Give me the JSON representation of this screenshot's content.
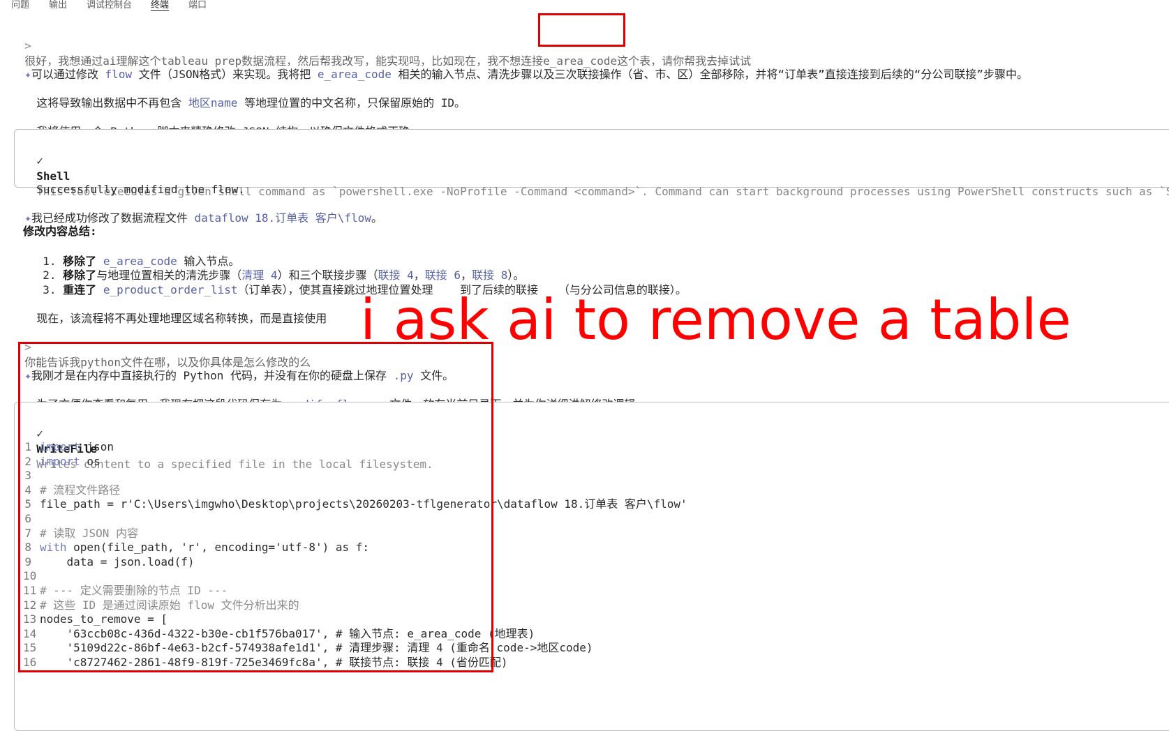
{
  "tabs": [
    "问题",
    "输出",
    "调试控制台",
    "终端",
    "端口"
  ],
  "messages": {
    "user1": "很好，我想通过ai理解这个tableau prep数据流程，然后帮我改写，能实现吗，比如现在，我不想连接e_area_code这个表，请你帮我去掉试试",
    "ai1_a": "可以通过修改 ",
    "ai1_flow": "flow",
    "ai1_b": " 文件（JSON格式）来实现。我将把 ",
    "ai1_code": "e_area_code",
    "ai1_c": " 相关的输入节点、清洗步骤以及三次联接操作（省、市、区）全部移除，并将“订单表”直接连接到后续的“分公司联接”步骤中。",
    "ai2_a": "这将导致输出数据中不再包含 ",
    "ai2_name": "地区name",
    "ai2_b": " 等地理位置的中文名称，只保留原始的 ID。",
    "ai3": "我将使用一个 Python 脚本来精确修改 JSON 结构，以确保文件格式正确。",
    "shell_check": "✓",
    "shell_name": "Shell",
    "shell_desc": "This tool executes a given shell command as `powershell.exe -NoProfile -Command <command>`. Command can start background processes using PowerShell constructs such as `Start",
    "shell_result": "Successfully modified the flow.",
    "ai4_a": "我已经成功修改了数据流程文件 ",
    "ai4_path": "dataflow 18.订单表 客户\\flow",
    "ai4_b": "。",
    "summary_title": "修改内容总结:",
    "item1_n": "1.",
    "item1_bold": "移除了",
    "item1_code": "e_area_code",
    "item1_rest": " 输入节点。",
    "item2_n": "2.",
    "item2_bold": "移除了",
    "item2_a": "与地理位置相关的清洗步骤（",
    "item2_c1": "清理 4",
    "item2_b": "）和三个联接步骤（",
    "item2_c2": "联接 4",
    "item2_sep1": "，",
    "item2_c3": "联接 6",
    "item2_sep2": "，",
    "item2_c4": "联接 8",
    "item2_end": "）。",
    "item3_n": "3.",
    "item3_bold": "重连了",
    "item3_code": "e_product_order_list",
    "item3_rest": "（订单表），使其直接跳过地理位置处理    到了后续的联接   （与分公司信息的联接）。",
    "ai5": "现在，该流程将不再处理地理区域名称转换，而是直接使用",
    "user2": "你能告诉我python文件在哪，以及你具体是怎么修改的么",
    "ai6_a": "我刚才是在内存中直接执行的 Python 代码，并没有在你的硬盘上保存 ",
    "ai6_py": ".py",
    "ai6_b": " 文件。",
    "ai7_a": "为了方便你查看和复用，我现在把这段代码保存为 ",
    "ai7_file": "modify_flow.py",
    "ai7_b": " 文件，放在当前目录下，并为你详细讲解修改逻辑。",
    "wf_check": "✓",
    "wf_name": "WriteFile",
    "wf_desc": "Writes content to a specified file in the local filesystem."
  },
  "code_lines": [
    {
      "n": "1",
      "kw": "import",
      "rest": " json"
    },
    {
      "n": "2",
      "kw": "import",
      "rest": " os"
    },
    {
      "n": "3",
      "kw": "",
      "rest": ""
    },
    {
      "n": "4",
      "kw": "",
      "rest": "# 流程文件路径"
    },
    {
      "n": "5",
      "kw": "",
      "rest": "file_path = r'C:\\Users\\imgwho\\Desktop\\projects\\20260203-tflgenerator\\dataflow 18.订单表 客户\\flow'"
    },
    {
      "n": "6",
      "kw": "",
      "rest": ""
    },
    {
      "n": "7",
      "kw": "",
      "rest": "# 读取 JSON 内容"
    },
    {
      "n": "8",
      "kw": "with",
      "rest": " open(file_path, 'r', encoding='utf-8') as f:"
    },
    {
      "n": "9",
      "kw": "",
      "rest": "    data = json.load(f)"
    },
    {
      "n": "10",
      "kw": "",
      "rest": ""
    },
    {
      "n": "11",
      "kw": "",
      "rest": "# --- 定义需要删除的节点 ID ---"
    },
    {
      "n": "12",
      "kw": "",
      "rest": "# 这些 ID 是通过阅读原始 flow 文件分析出来的"
    },
    {
      "n": "13",
      "kw": "",
      "rest": "nodes_to_remove = ["
    },
    {
      "n": "14",
      "kw": "",
      "rest": "    '63ccb08c-436d-4322-b30e-cb1f576ba017', # 输入节点: e_area_code (地理表)"
    },
    {
      "n": "15",
      "kw": "",
      "rest": "    '5109d22c-86bf-4e63-b2cf-574938afe1d1', # 清理步骤: 清理 4 (重命名 code->地区code)"
    },
    {
      "n": "16",
      "kw": "",
      "rest": "    'c8727462-2861-48f9-819f-725e3469fc8a', # 联接节点: 联接 4 (省份匹配)"
    }
  ],
  "annotation": "i ask ai to remove a table"
}
